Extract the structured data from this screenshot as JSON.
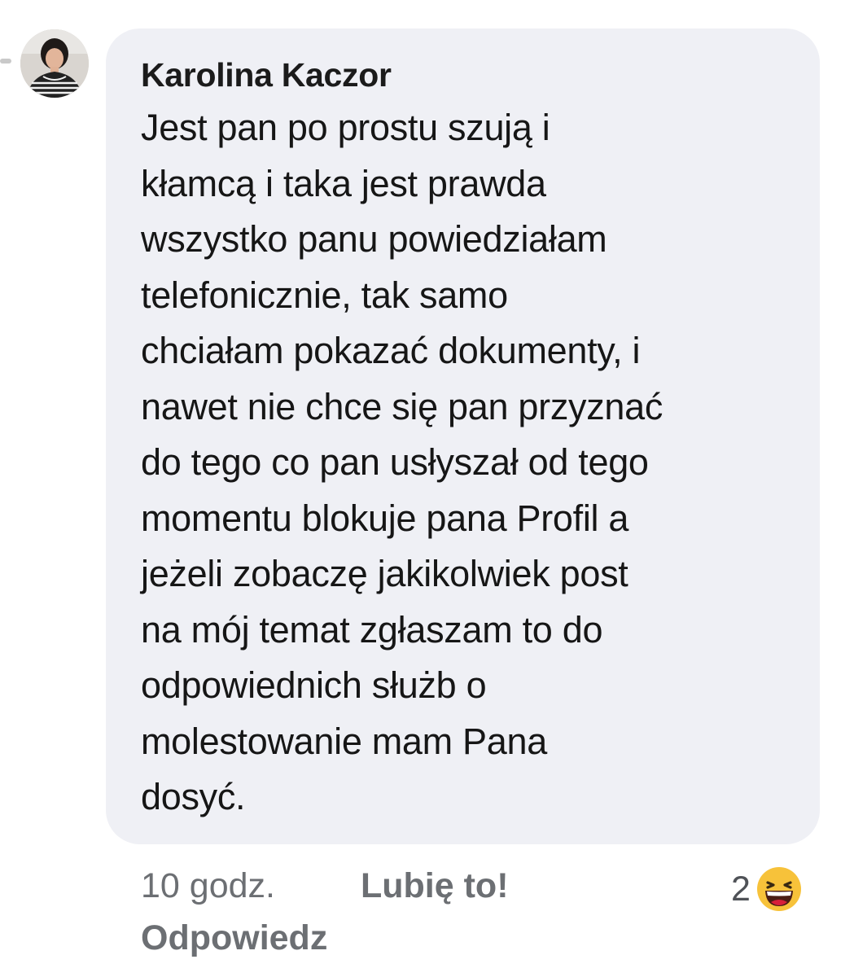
{
  "comment": {
    "author": "Karolina Kaczor",
    "text": "Jest pan po prostu szują i\nkłamcą i taka jest prawda\nwszystko panu powiedziałam\ntelefonicznie, tak samo\nchciałam pokazać dokumenty, i\nnawet nie chce się pan przyznać\ndo tego co pan usłyszał od tego\nmomentu blokuje pana Profil a\njeżeli zobaczę jakikolwiek post\nna mój temat zgłaszam to do\nodpowiednich służb o\nmolestowanie mam Pana\ndosyć.",
    "time": "10 godz.",
    "like_label": "Lubię to!",
    "reply_label": "Odpowiedz",
    "reaction_count": "2",
    "reaction_icon": "haha-emoji-icon"
  },
  "colors": {
    "bubble": "#eff0f5",
    "text": "#161616",
    "meta": "#6c6f73",
    "emoji_yellow": "#f7c23a",
    "emoji_mouth": "#d8203a"
  }
}
